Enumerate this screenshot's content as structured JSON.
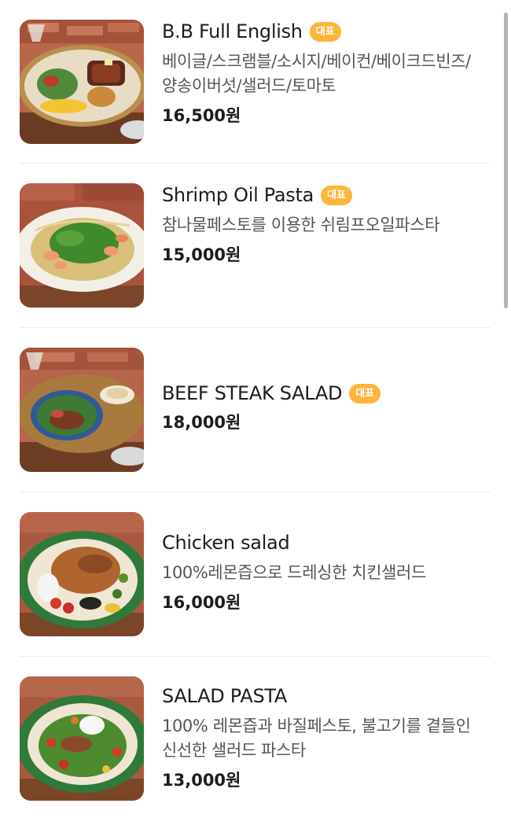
{
  "badge_color": "#ffb43c",
  "items": [
    {
      "name": "B.B Full English",
      "badge": "대표",
      "desc": "베이글/스크램블/소시지/베이컨/베이크드빈즈/양송이버섯/샐러드/토마토",
      "price": "16,500원",
      "image": "full-english-breakfast-plate"
    },
    {
      "name": "Shrimp Oil Pasta",
      "badge": "대표",
      "desc": "참나물페스토를 이용한 쉬림프오일파스타",
      "price": "15,000원",
      "image": "shrimp-oil-pasta-plate"
    },
    {
      "name": "BEEF STEAK SALAD",
      "badge": "대표",
      "desc": "",
      "price": "18,000원",
      "image": "beef-steak-salad-plate"
    },
    {
      "name": "Chicken salad",
      "badge": "",
      "desc": "100%레몬즙으로 드레싱한 치킨샐러드",
      "price": "16,000원",
      "image": "chicken-salad-plate"
    },
    {
      "name": "SALAD PASTA",
      "badge": "",
      "desc": "100% 레몬즙과 바질페스토, 불고기를 곁들인 신선한 샐러드 파스타",
      "price": "13,000원",
      "image": "salad-pasta-plate"
    }
  ]
}
